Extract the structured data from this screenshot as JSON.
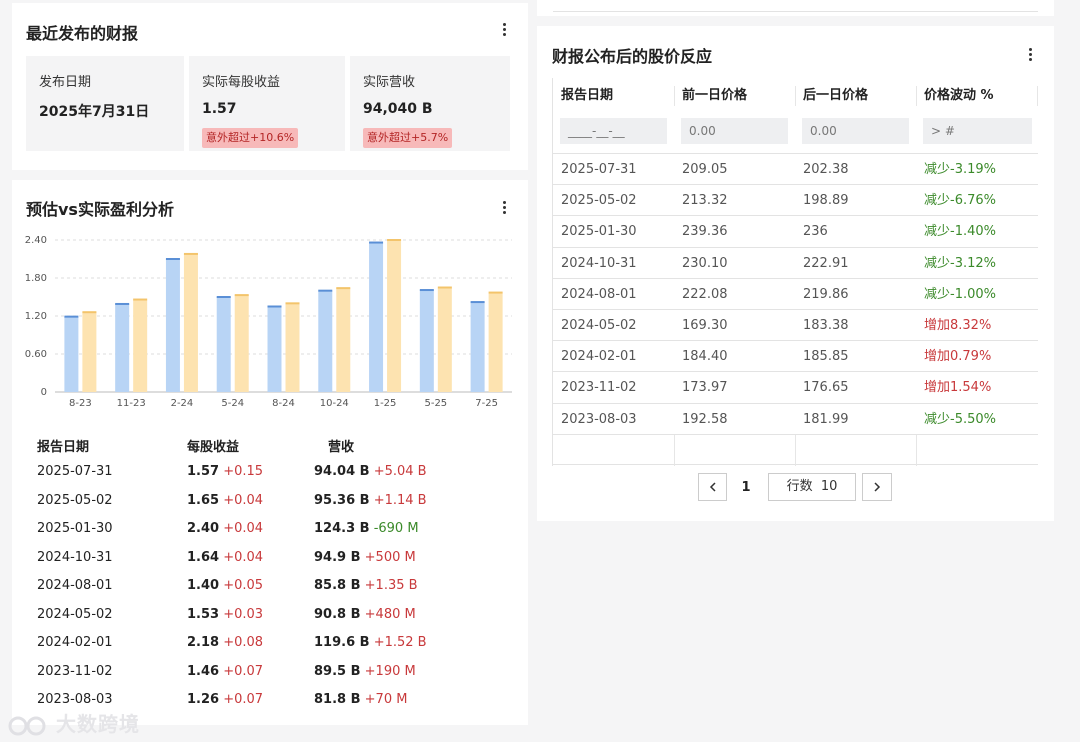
{
  "latest_report": {
    "title": "最近发布的财报",
    "boxes": [
      {
        "label": "发布日期",
        "value": "2025年7月31日",
        "badge": ""
      },
      {
        "label": "实际每股收益",
        "value": "1.57",
        "badge": "意外超过+10.6%"
      },
      {
        "label": "实际营收",
        "value": "94,040 B",
        "badge": "意外超过+5.7%"
      }
    ]
  },
  "eps_analysis": {
    "title": "预估vs实际盈利分析",
    "table_headers": {
      "date": "报告日期",
      "eps": "每股收益",
      "revenue": "营收"
    },
    "rows": [
      {
        "date": "2025-07-31",
        "eps": "1.57",
        "eps_delta": "+0.15",
        "rev": "94.04 B",
        "rev_delta": "+5.04 B"
      },
      {
        "date": "2025-05-02",
        "eps": "1.65",
        "eps_delta": "+0.04",
        "rev": "95.36 B",
        "rev_delta": "+1.14 B"
      },
      {
        "date": "2025-01-30",
        "eps": "2.40",
        "eps_delta": "+0.04",
        "rev": "124.3 B",
        "rev_delta": "-690 M"
      },
      {
        "date": "2024-10-31",
        "eps": "1.64",
        "eps_delta": "+0.04",
        "rev": "94.9 B",
        "rev_delta": "+500 M"
      },
      {
        "date": "2024-08-01",
        "eps": "1.40",
        "eps_delta": "+0.05",
        "rev": "85.8 B",
        "rev_delta": "+1.35 B"
      },
      {
        "date": "2024-05-02",
        "eps": "1.53",
        "eps_delta": "+0.03",
        "rev": "90.8 B",
        "rev_delta": "+480 M"
      },
      {
        "date": "2024-02-01",
        "eps": "2.18",
        "eps_delta": "+0.08",
        "rev": "119.6 B",
        "rev_delta": "+1.52 B"
      },
      {
        "date": "2023-11-02",
        "eps": "1.46",
        "eps_delta": "+0.07",
        "rev": "89.5 B",
        "rev_delta": "+190 M"
      },
      {
        "date": "2023-08-03",
        "eps": "1.26",
        "eps_delta": "+0.07",
        "rev": "81.8 B",
        "rev_delta": "+70 M"
      }
    ]
  },
  "chart_data": {
    "type": "bar",
    "categories": [
      "8-23",
      "11-23",
      "2-24",
      "5-24",
      "8-24",
      "10-24",
      "1-25",
      "5-25",
      "7-25"
    ],
    "series": [
      {
        "values": [
          1.19,
          1.39,
          2.1,
          1.5,
          1.35,
          1.6,
          2.36,
          1.61,
          1.42
        ],
        "color": "#b8d4f5"
      },
      {
        "values": [
          1.26,
          1.46,
          2.18,
          1.53,
          1.4,
          1.64,
          2.4,
          1.65,
          1.57
        ],
        "color": "#fde3b0"
      }
    ],
    "yticks": [
      "0",
      "0.60",
      "1.20",
      "1.80",
      "2.40"
    ],
    "ylim": [
      0,
      2.4
    ],
    "grid": true
  },
  "price_reaction": {
    "title": "财报公布后的股价反应",
    "headers": [
      "报告日期",
      "前一日价格",
      "后一日价格",
      "价格波动 %"
    ],
    "filters": [
      "____-__-__",
      "0.00",
      "0.00",
      "> #"
    ],
    "rows": [
      {
        "date": "2025-07-31",
        "before": "209.05",
        "after": "202.38",
        "change": "减少-3.19%",
        "dir": "down"
      },
      {
        "date": "2025-05-02",
        "before": "213.32",
        "after": "198.89",
        "change": "减少-6.76%",
        "dir": "down"
      },
      {
        "date": "2025-01-30",
        "before": "239.36",
        "after": "236",
        "change": "减少-1.40%",
        "dir": "down"
      },
      {
        "date": "2024-10-31",
        "before": "230.10",
        "after": "222.91",
        "change": "减少-3.12%",
        "dir": "down"
      },
      {
        "date": "2024-08-01",
        "before": "222.08",
        "after": "219.86",
        "change": "减少-1.00%",
        "dir": "down"
      },
      {
        "date": "2024-05-02",
        "before": "169.30",
        "after": "183.38",
        "change": "增加8.32%",
        "dir": "up"
      },
      {
        "date": "2024-02-01",
        "before": "184.40",
        "after": "185.85",
        "change": "增加0.79%",
        "dir": "up"
      },
      {
        "date": "2023-11-02",
        "before": "173.97",
        "after": "176.65",
        "change": "增加1.54%",
        "dir": "up"
      },
      {
        "date": "2023-08-03",
        "before": "192.58",
        "after": "181.99",
        "change": "减少-5.50%",
        "dir": "down"
      }
    ],
    "pager": {
      "prev_icon": "chevron-left-icon",
      "page": "1",
      "rows_label": "行数",
      "rows_value": "10",
      "next_icon": "chevron-right-icon"
    }
  },
  "colors": {
    "up": "#c8393b",
    "down": "#3b8a2a",
    "badge_bg": "#f7b9b9"
  },
  "watermark": "大数跨境"
}
